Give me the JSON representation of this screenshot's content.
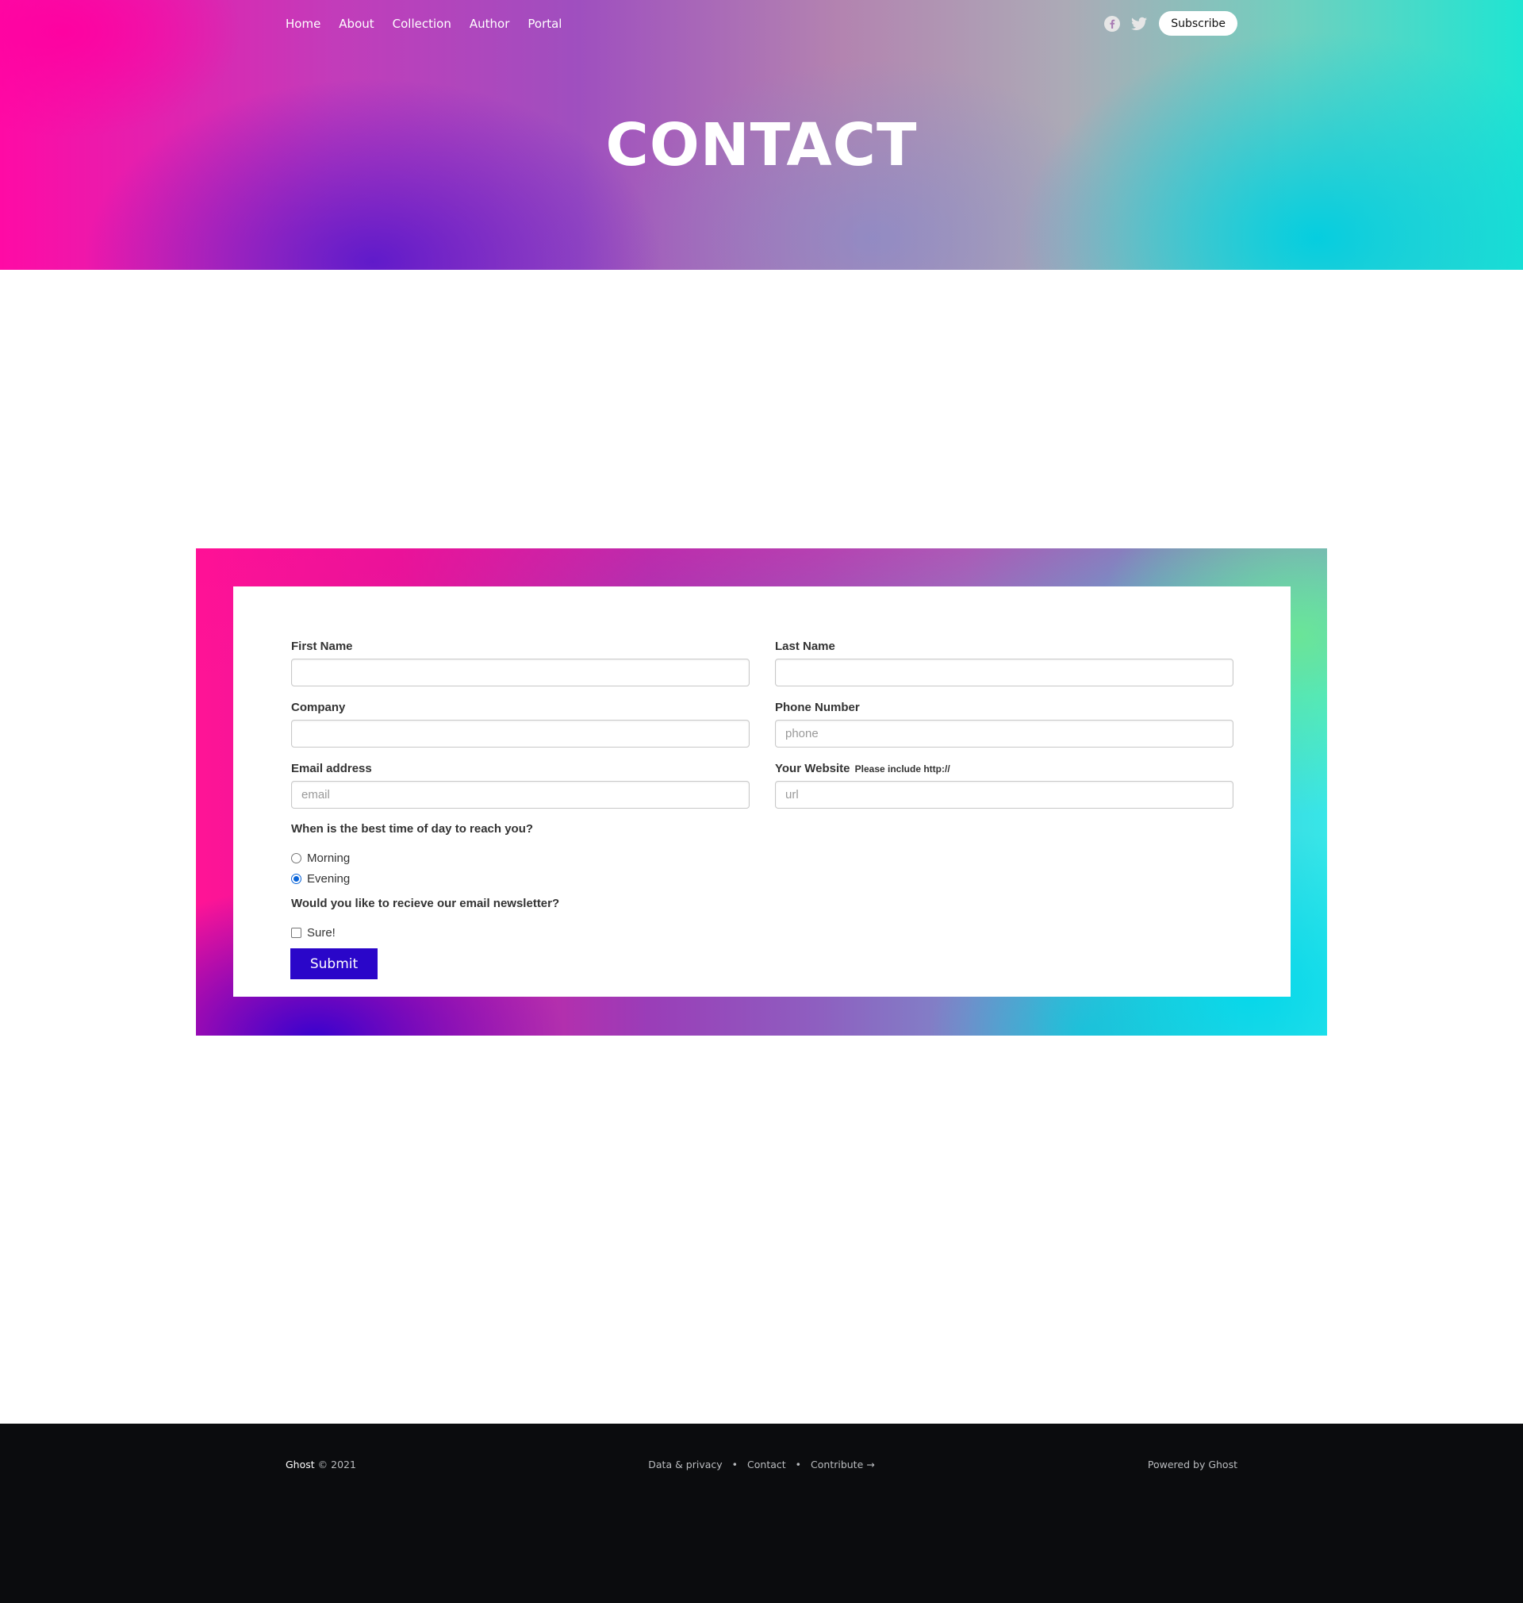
{
  "nav": {
    "items": [
      "Home",
      "About",
      "Collection",
      "Author",
      "Portal"
    ],
    "subscribe_label": "Subscribe",
    "social": [
      "facebook-icon",
      "twitter-icon"
    ]
  },
  "page": {
    "title": "CONTACT"
  },
  "form": {
    "first_name": {
      "label": "First Name",
      "placeholder": "",
      "value": ""
    },
    "last_name": {
      "label": "Last Name",
      "placeholder": "",
      "value": ""
    },
    "company": {
      "label": "Company",
      "placeholder": "",
      "value": ""
    },
    "phone": {
      "label": "Phone Number",
      "placeholder": "phone",
      "value": ""
    },
    "email": {
      "label": "Email address",
      "placeholder": "email",
      "value": ""
    },
    "website": {
      "label": "Your Website",
      "hint": "Please include http://",
      "placeholder": "url",
      "value": ""
    },
    "time_question": "When is the best time of day to reach you?",
    "time_options": [
      {
        "label": "Morning",
        "checked": false
      },
      {
        "label": "Evening",
        "checked": true
      }
    ],
    "newsletter_question": "Would you like to recieve our email newsletter?",
    "newsletter_option": {
      "label": "Sure!",
      "checked": false
    },
    "submit_label": "Submit"
  },
  "footer": {
    "brand": "Ghost",
    "copyright": "© 2021",
    "links": [
      "Data & privacy",
      "Contact",
      "Contribute →"
    ],
    "separator": "•",
    "powered_by": "Powered by Ghost"
  },
  "colors": {
    "submit_button": "#2a06c9",
    "footer_bg": "#0b0c0e",
    "gradient_pink": "#ff0aa5",
    "gradient_purple": "#5014cd",
    "gradient_cyan": "#00cde1"
  }
}
